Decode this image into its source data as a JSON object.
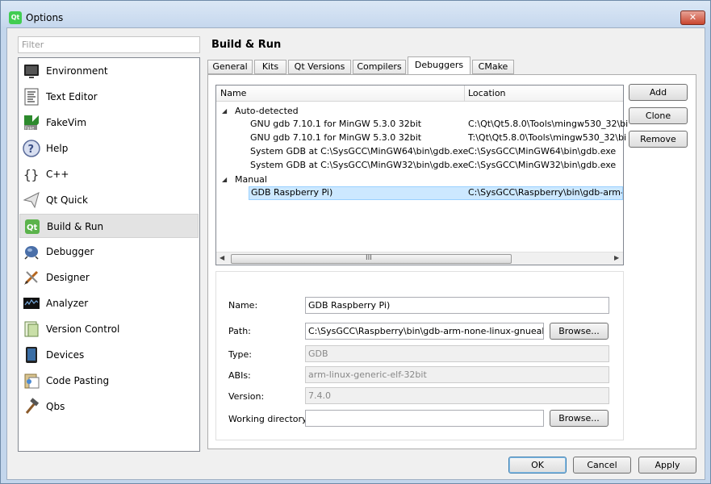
{
  "window": {
    "title": "Options",
    "close_label": "✕"
  },
  "sidebar": {
    "filter_placeholder": "Filter",
    "items": [
      {
        "label": "Environment",
        "icon": "monitor-icon"
      },
      {
        "label": "Text Editor",
        "icon": "text-editor-icon"
      },
      {
        "label": "FakeVim",
        "icon": "fakevim-icon"
      },
      {
        "label": "Help",
        "icon": "help-icon"
      },
      {
        "label": "C++",
        "icon": "braces-icon"
      },
      {
        "label": "Qt Quick",
        "icon": "qt-quick-icon"
      },
      {
        "label": "Build & Run",
        "icon": "build-run-icon",
        "selected": true
      },
      {
        "label": "Debugger",
        "icon": "debugger-icon"
      },
      {
        "label": "Designer",
        "icon": "designer-icon"
      },
      {
        "label": "Analyzer",
        "icon": "analyzer-icon"
      },
      {
        "label": "Version Control",
        "icon": "version-control-icon"
      },
      {
        "label": "Devices",
        "icon": "devices-icon"
      },
      {
        "label": "Code Pasting",
        "icon": "code-pasting-icon"
      },
      {
        "label": "Qbs",
        "icon": "hammer-icon"
      }
    ]
  },
  "page": {
    "title": "Build & Run",
    "tabs": [
      "General",
      "Kits",
      "Qt Versions",
      "Compilers",
      "Debuggers",
      "CMake"
    ],
    "active_tab": "Debuggers"
  },
  "debuggers": {
    "columns": [
      "Name",
      "Location"
    ],
    "groups": [
      {
        "label": "Auto-detected",
        "rows": [
          {
            "name": "GNU gdb 7.10.1 for MinGW 5.3.0 32bit",
            "location": "C:\\Qt\\Qt5.8.0\\Tools\\mingw530_32\\bi"
          },
          {
            "name": "GNU gdb 7.10.1 for MinGW 5.3.0 32bit",
            "location": "T:\\Qt\\Qt5.8.0\\Tools\\mingw530_32\\bi"
          },
          {
            "name": "System GDB at C:\\SysGCC\\MinGW64\\bin\\gdb.exe",
            "location": "C:\\SysGCC\\MinGW64\\bin\\gdb.exe"
          },
          {
            "name": "System GDB at C:\\SysGCC\\MinGW32\\bin\\gdb.exe",
            "location": "C:\\SysGCC\\MinGW32\\bin\\gdb.exe"
          }
        ]
      },
      {
        "label": "Manual",
        "rows": [
          {
            "name": "GDB Raspberry Pi)",
            "location": "C:\\SysGCC\\Raspberry\\bin\\gdb-arm-",
            "selected": true
          }
        ]
      }
    ],
    "scroll_grip": "III",
    "buttons": {
      "add": "Add",
      "clone": "Clone",
      "remove": "Remove"
    }
  },
  "details": {
    "name_label": "Name:",
    "name_value": "GDB Raspberry Pi)",
    "path_label": "Path:",
    "path_value": "C:\\SysGCC\\Raspberry\\bin\\gdb-arm-none-linux-gnueabi.exe",
    "browse_label": "Browse...",
    "type_label": "Type:",
    "type_value": "GDB",
    "abis_label": "ABIs:",
    "abis_value": "arm-linux-generic-elf-32bit",
    "version_label": "Version:",
    "version_value": "7.4.0",
    "workdir_label": "Working directory:",
    "workdir_value": "",
    "workdir_browse_label": "Browse..."
  },
  "footer": {
    "ok": "OK",
    "cancel": "Cancel",
    "apply": "Apply"
  }
}
